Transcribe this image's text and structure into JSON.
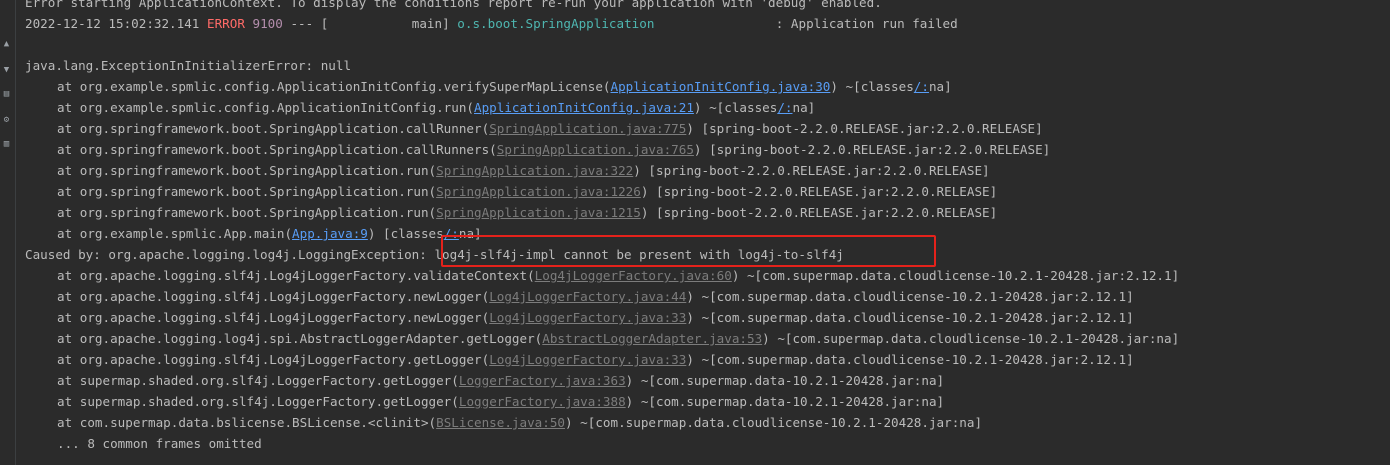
{
  "gutter_icons": [
    "arrow-up-icon",
    "arrow-down-icon",
    "print-icon",
    "settings-icon",
    "trash-icon"
  ],
  "header": {
    "prev_line": "Error starting ApplicationContext. To display the conditions report re-run your application with 'debug' enabled.",
    "timestamp": "2022-12-12 15:02:32.141",
    "level": "ERROR",
    "pid": "9100",
    "sep": "--- [",
    "thread": "           main]",
    "logger": "o.s.boot.SpringApplication",
    "message": ": Application run failed"
  },
  "exception": {
    "head": "java.lang.ExceptionInInitializerError: null",
    "frames": [
      {
        "method": "at org.example.spmlic.config.ApplicationInitConfig.verifySuperMapLicense(",
        "link": "ApplicationInitConfig.java:30",
        "after": ") ~[classes",
        "link2": "/:",
        "tail": "na]",
        "style": "blue"
      },
      {
        "method": "at org.example.spmlic.config.ApplicationInitConfig.run(",
        "link": "ApplicationInitConfig.java:21",
        "after": ") ~[classes",
        "link2": "/:",
        "tail": "na]",
        "style": "blue"
      },
      {
        "method": "at org.springframework.boot.SpringApplication.callRunner(",
        "link": "SpringApplication.java:775",
        "after": ") [spring-boot-2.2.0.RELEASE.jar:2.2.0.RELEASE]",
        "link2": "",
        "tail": "",
        "style": "gray"
      },
      {
        "method": "at org.springframework.boot.SpringApplication.callRunners(",
        "link": "SpringApplication.java:765",
        "after": ") [spring-boot-2.2.0.RELEASE.jar:2.2.0.RELEASE]",
        "link2": "",
        "tail": "",
        "style": "gray"
      },
      {
        "method": "at org.springframework.boot.SpringApplication.run(",
        "link": "SpringApplication.java:322",
        "after": ") [spring-boot-2.2.0.RELEASE.jar:2.2.0.RELEASE]",
        "link2": "",
        "tail": "",
        "style": "gray"
      },
      {
        "method": "at org.springframework.boot.SpringApplication.run(",
        "link": "SpringApplication.java:1226",
        "after": ") [spring-boot-2.2.0.RELEASE.jar:2.2.0.RELEASE]",
        "link2": "",
        "tail": "",
        "style": "gray"
      },
      {
        "method": "at org.springframework.boot.SpringApplication.run(",
        "link": "SpringApplication.java:1215",
        "after": ") [spring-boot-2.2.0.RELEASE.jar:2.2.0.RELEASE]",
        "link2": "",
        "tail": "",
        "style": "gray"
      },
      {
        "method": "at org.example.spmlic.App.main(",
        "link": "App.java:9",
        "after": ") [classes",
        "link2": "/:",
        "tail": "na]",
        "style": "blue"
      }
    ]
  },
  "caused_by": {
    "prefix": "Caused by: org.apache.logging.log4j.LoggingException:",
    "message": " log4j-slf4j-impl cannot be present with log4j-to-slf4j",
    "frames": [
      {
        "method": "at org.apache.logging.slf4j.Log4jLoggerFactory.validateContext(",
        "link": "Log4jLoggerFactory.java:60",
        "after": ") ~[com.supermap.data.cloudlicense-10.2.1-20428.jar:2.12.1]"
      },
      {
        "method": "at org.apache.logging.slf4j.Log4jLoggerFactory.newLogger(",
        "link": "Log4jLoggerFactory.java:44",
        "after": ") ~[com.supermap.data.cloudlicense-10.2.1-20428.jar:2.12.1]"
      },
      {
        "method": "at org.apache.logging.slf4j.Log4jLoggerFactory.newLogger(",
        "link": "Log4jLoggerFactory.java:33",
        "after": ") ~[com.supermap.data.cloudlicense-10.2.1-20428.jar:2.12.1]"
      },
      {
        "method": "at org.apache.logging.log4j.spi.AbstractLoggerAdapter.getLogger(",
        "link": "AbstractLoggerAdapter.java:53",
        "after": ") ~[com.supermap.data.cloudlicense-10.2.1-20428.jar:na]"
      },
      {
        "method": "at org.apache.logging.slf4j.Log4jLoggerFactory.getLogger(",
        "link": "Log4jLoggerFactory.java:33",
        "after": ") ~[com.supermap.data.cloudlicense-10.2.1-20428.jar:2.12.1]"
      },
      {
        "method": "at supermap.shaded.org.slf4j.LoggerFactory.getLogger(",
        "link": "LoggerFactory.java:363",
        "after": ") ~[com.supermap.data-10.2.1-20428.jar:na]"
      },
      {
        "method": "at supermap.shaded.org.slf4j.LoggerFactory.getLogger(",
        "link": "LoggerFactory.java:388",
        "after": ") ~[com.supermap.data-10.2.1-20428.jar:na]"
      },
      {
        "method": "at com.supermap.data.bslicense.BSLicense.<clinit>(",
        "link": "BSLicense.java:50",
        "after": ") ~[com.supermap.data.cloudlicense-10.2.1-20428.jar:na]"
      }
    ],
    "omitted": "... 8 common frames omitted"
  },
  "colors": {
    "background": "#2b2b2b",
    "text": "#bbbbbb",
    "error": "#ff6b68",
    "pid": "#b48ead",
    "logger": "#4eb6b0",
    "link": "#589df6",
    "library_link": "#7c7c7c",
    "highlight_box": "#e5221b"
  }
}
